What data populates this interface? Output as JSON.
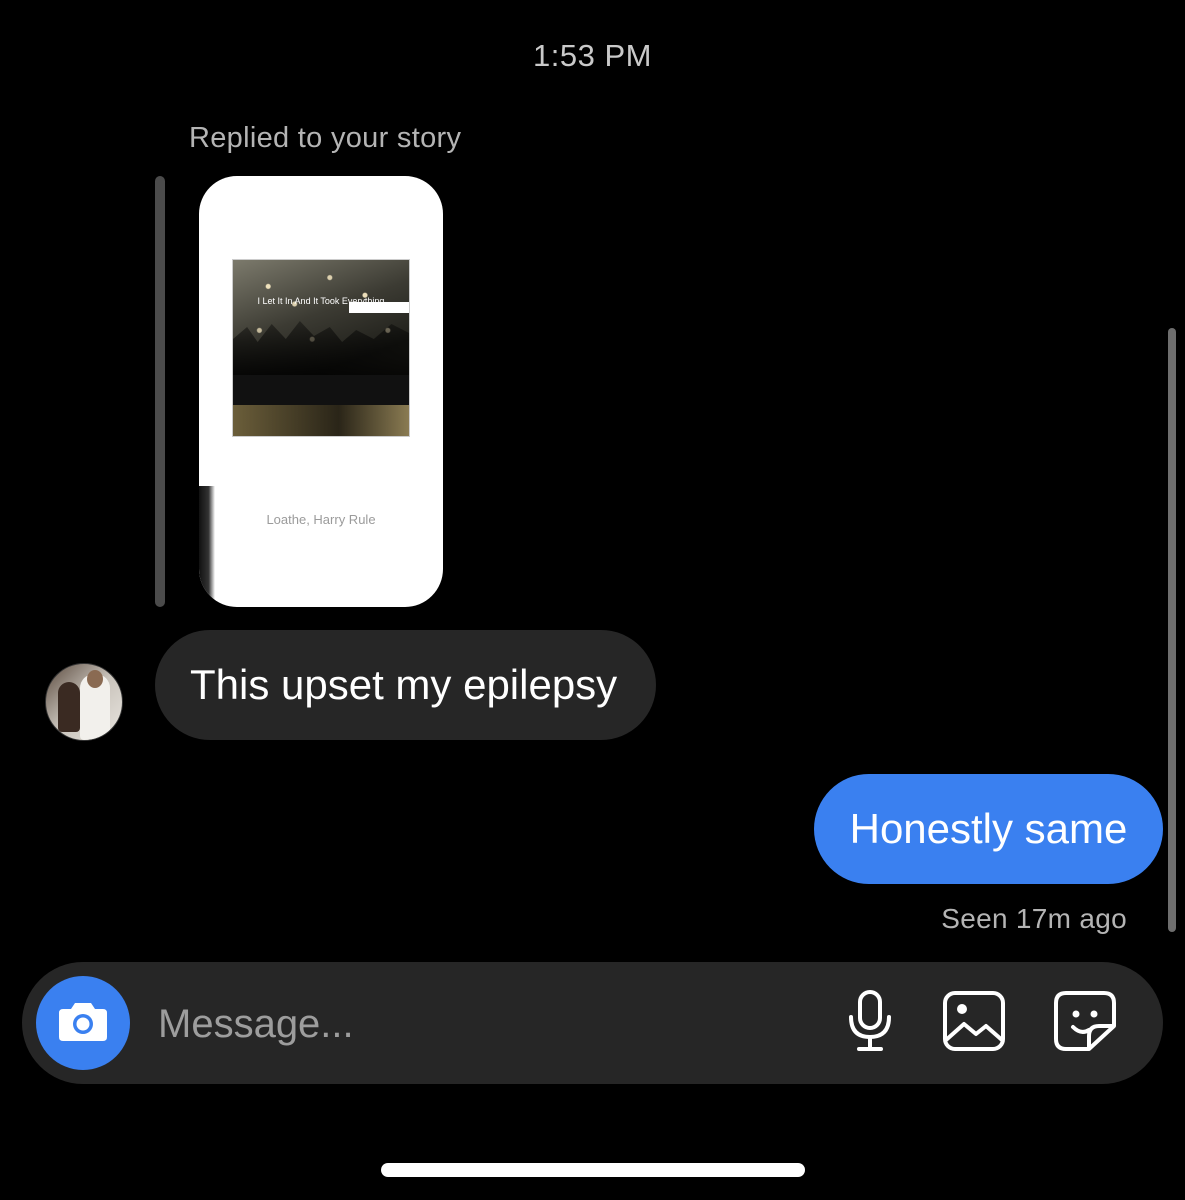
{
  "conversation": {
    "timestamp": "1:53 PM",
    "reply_label": "Replied to your story",
    "story": {
      "album_title": "I Let It In And It Took Everything",
      "artist": "Loathe, Harry Rule"
    },
    "incoming_message": "This upset my epilepsy",
    "outgoing_message": "Honestly same",
    "seen_status": "Seen 17m ago"
  },
  "composer": {
    "placeholder": "Message..."
  },
  "icons": {
    "camera": "camera-icon",
    "mic": "microphone-icon",
    "gallery": "image-icon",
    "sticker": "sticker-icon"
  },
  "colors": {
    "background": "#000000",
    "accent": "#3a80f0",
    "incoming_bubble": "#262626"
  }
}
